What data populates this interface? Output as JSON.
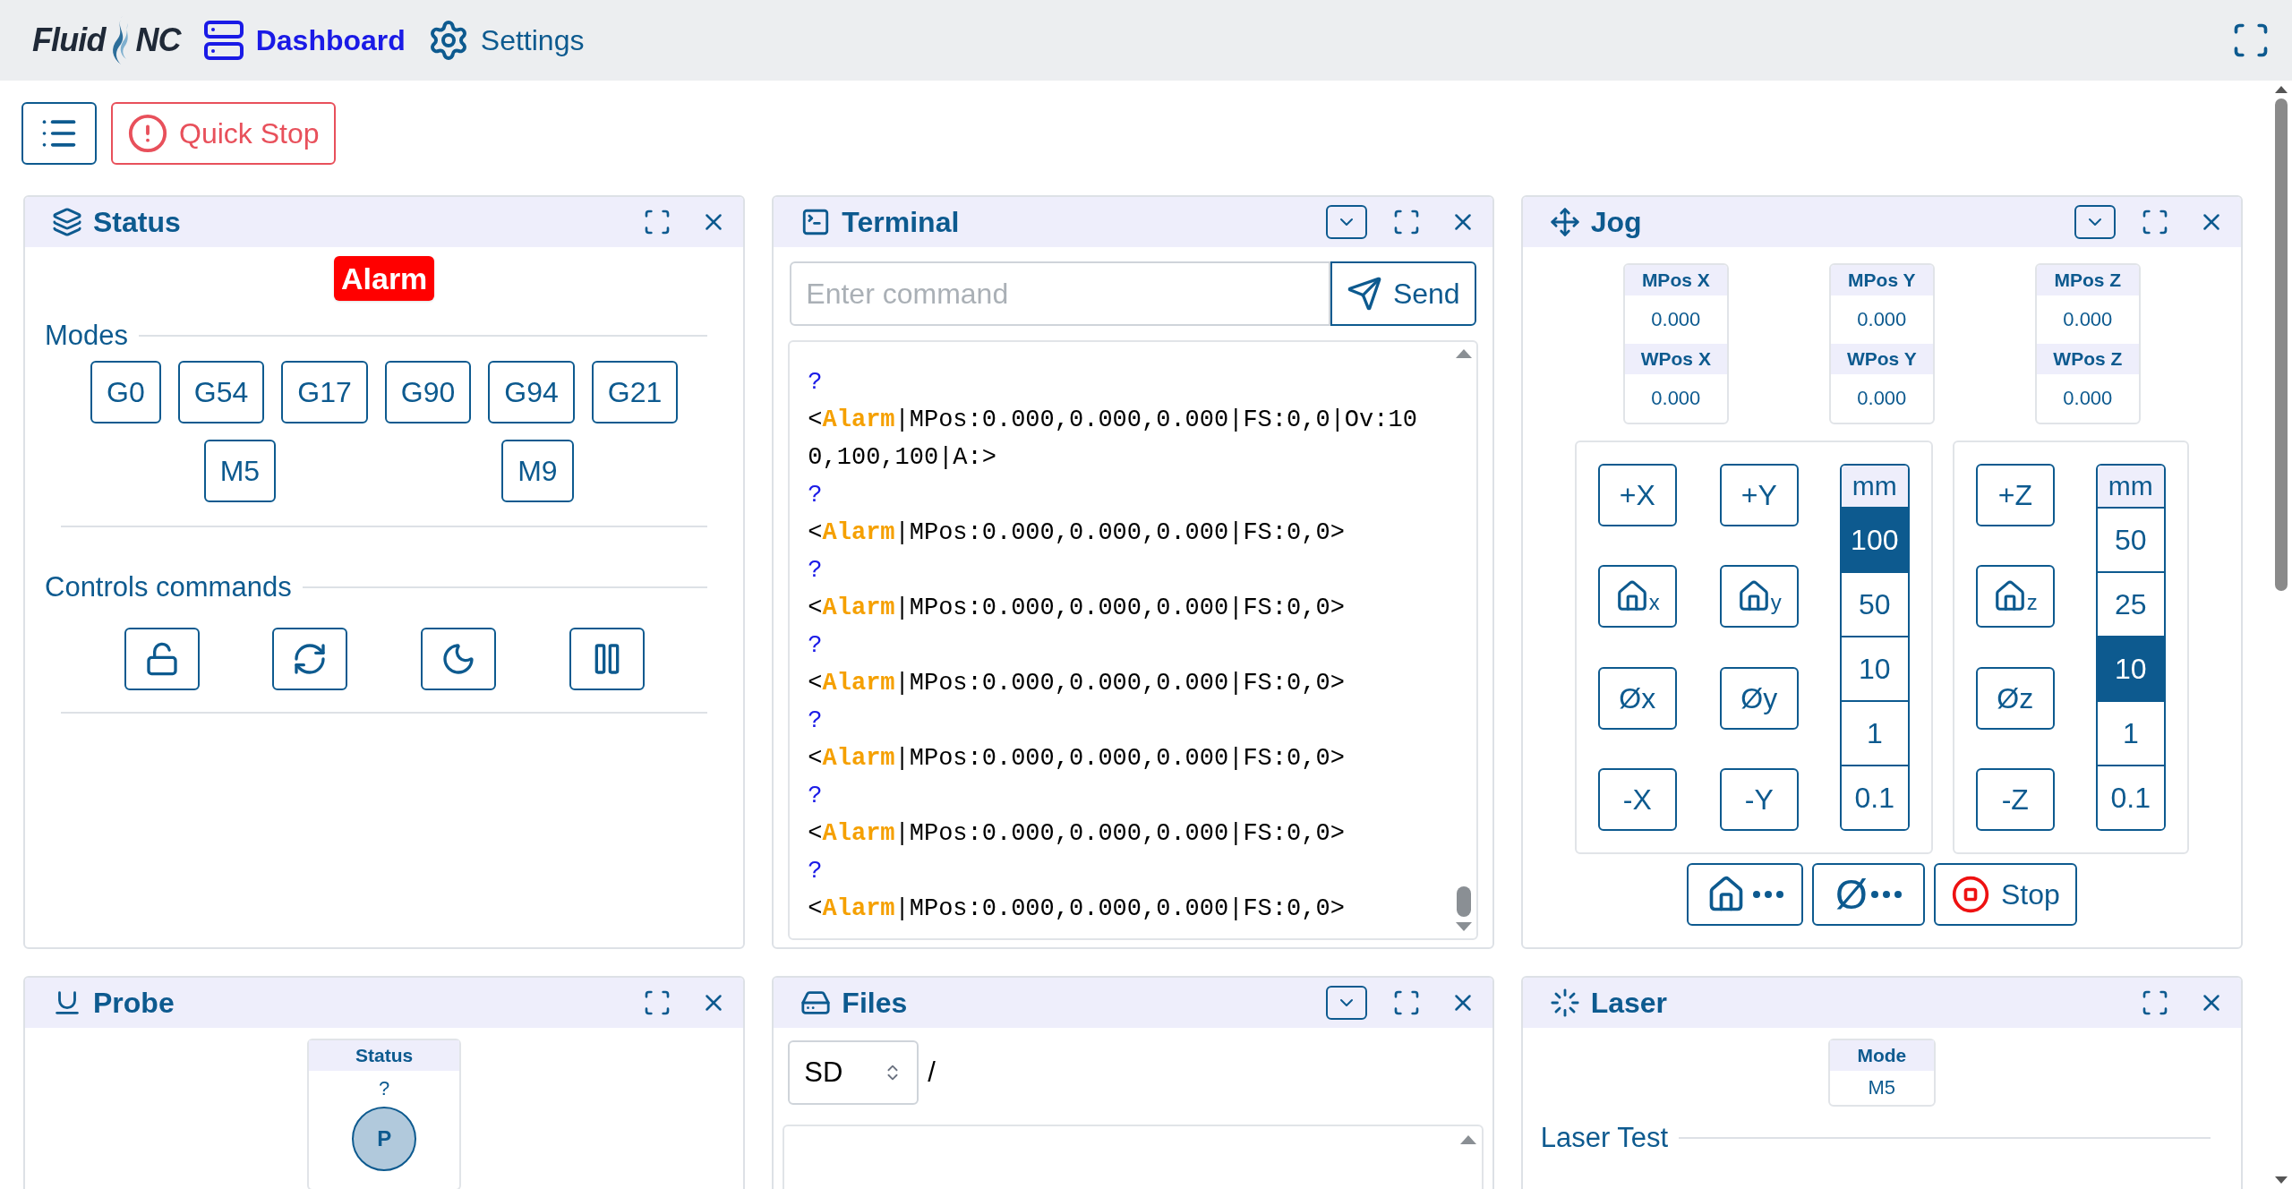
{
  "navbar": {
    "logo": [
      "Fluid",
      "NC"
    ],
    "tabs": [
      {
        "label": "Dashboard",
        "selected": true
      },
      {
        "label": "Settings",
        "selected": false
      }
    ]
  },
  "toolbar": {
    "quick_stop": "Quick Stop"
  },
  "status": {
    "title": "Status",
    "collapse_button": false,
    "state": "Alarm",
    "modes_legend": "Modes",
    "modes": [
      [
        "G0",
        "G54",
        "G17",
        "G90",
        "G94",
        "G21"
      ],
      [
        "M5",
        "M9"
      ]
    ],
    "controls_legend": "Controls commands"
  },
  "terminal": {
    "title": "Terminal",
    "collapse_button": true,
    "placeholder": "Enter command",
    "send": "Send",
    "lines": [
      {
        "kind": "query",
        "text": "?"
      },
      {
        "kind": "status",
        "open": "<",
        "state": "Alarm",
        "rest": "|MPos:0.000,0.000,0.000|FS:0,0|Ov:100,100,100|A:>"
      },
      {
        "kind": "query",
        "text": "?"
      },
      {
        "kind": "status",
        "open": "<",
        "state": "Alarm",
        "rest": "|MPos:0.000,0.000,0.000|FS:0,0>"
      },
      {
        "kind": "query",
        "text": "?"
      },
      {
        "kind": "status",
        "open": "<",
        "state": "Alarm",
        "rest": "|MPos:0.000,0.000,0.000|FS:0,0>"
      },
      {
        "kind": "query",
        "text": "?"
      },
      {
        "kind": "status",
        "open": "<",
        "state": "Alarm",
        "rest": "|MPos:0.000,0.000,0.000|FS:0,0>"
      },
      {
        "kind": "query",
        "text": "?"
      },
      {
        "kind": "status",
        "open": "<",
        "state": "Alarm",
        "rest": "|MPos:0.000,0.000,0.000|FS:0,0>"
      },
      {
        "kind": "query",
        "text": "?"
      },
      {
        "kind": "status",
        "open": "<",
        "state": "Alarm",
        "rest": "|MPos:0.000,0.000,0.000|FS:0,0>"
      },
      {
        "kind": "query",
        "text": "?"
      },
      {
        "kind": "status",
        "open": "<",
        "state": "Alarm",
        "rest": "|MPos:0.000,0.000,0.000|FS:0,0>"
      }
    ]
  },
  "jog": {
    "title": "Jog",
    "collapse_button": true,
    "positions": [
      {
        "mlabel": "MPos X",
        "mvalue": "0.000",
        "wlabel": "WPos X",
        "wvalue": "0.000"
      },
      {
        "mlabel": "MPos Y",
        "mvalue": "0.000",
        "wlabel": "WPos Y",
        "wvalue": "0.000"
      },
      {
        "mlabel": "MPos Z",
        "mvalue": "0.000",
        "wlabel": "WPos Z",
        "wvalue": "0.000"
      }
    ],
    "groups": [
      {
        "buttons": [
          {
            "kind": "text",
            "label": "+X"
          },
          {
            "kind": "text",
            "label": "+Y"
          },
          {
            "kind": "home",
            "label": "x"
          },
          {
            "kind": "home",
            "label": "y"
          },
          {
            "kind": "text",
            "label": "Øx"
          },
          {
            "kind": "text",
            "label": "Øy"
          },
          {
            "kind": "text",
            "label": "-X"
          },
          {
            "kind": "text",
            "label": "-Y"
          }
        ],
        "unit": "mm",
        "steps": [
          {
            "label": "100",
            "selected": true
          },
          {
            "label": "50",
            "selected": false
          },
          {
            "label": "10",
            "selected": false
          },
          {
            "label": "1",
            "selected": false
          },
          {
            "label": "0.1",
            "selected": false
          }
        ]
      },
      {
        "buttons": [
          {
            "kind": "text",
            "label": "+Z"
          },
          {
            "kind": "home",
            "label": "z"
          },
          {
            "kind": "text",
            "label": "Øz"
          },
          {
            "kind": "text",
            "label": "-Z"
          }
        ],
        "unit": "mm",
        "steps": [
          {
            "label": "50",
            "selected": false
          },
          {
            "label": "25",
            "selected": false
          },
          {
            "label": "10",
            "selected": true
          },
          {
            "label": "1",
            "selected": false
          },
          {
            "label": "0.1",
            "selected": false
          }
        ]
      }
    ],
    "actions": [
      {
        "kind": "home_all"
      },
      {
        "kind": "zero_all",
        "label": "Ø"
      },
      {
        "kind": "stop",
        "label": "Stop"
      }
    ]
  },
  "probe": {
    "title": "Probe",
    "collapse_button": false,
    "status_label": "Status",
    "status_value": "?",
    "pin": "P"
  },
  "files": {
    "title": "Files",
    "collapse_button": true,
    "source": "SD",
    "path": "/"
  },
  "laser": {
    "title": "Laser",
    "collapse_button": false,
    "mode_label": "Mode",
    "mode_value": "M5",
    "test_legend": "Laser Test"
  }
}
